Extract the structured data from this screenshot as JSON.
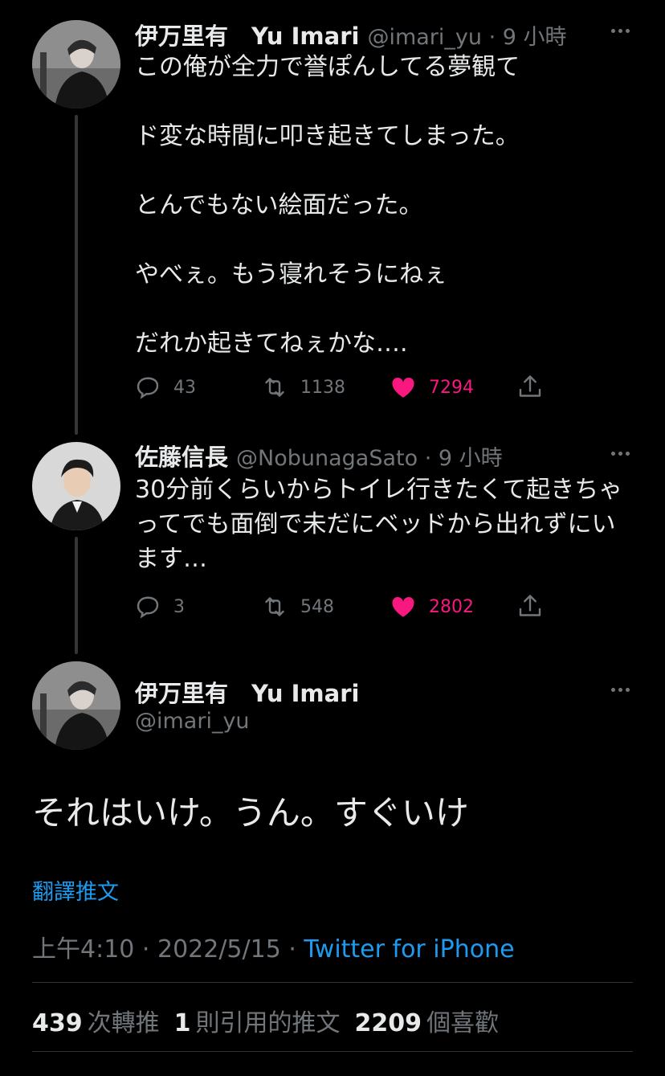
{
  "tweets": [
    {
      "display_name": "伊万里有　Yu Imari",
      "handle": "@imari_yu",
      "time": "9 小時",
      "text": "この俺が全力で誉ぽんしてる夢観て\n\nド変な時間に叩き起きてしまった。\n\nとんでもない絵面だった。\n\nやべぇ。もう寝れそうにねぇ\n\nだれか起きてねぇかな….",
      "replies": "43",
      "retweets": "1138",
      "likes": "7294"
    },
    {
      "display_name": "佐藤信長",
      "handle": "@NobunagaSato",
      "time": "9 小時",
      "text": "30分前くらいからトイレ行きたくて起きちゃってでも面倒で未だにベッドから出れずにいます…",
      "replies": "3",
      "retweets": "548",
      "likes": "2802"
    }
  ],
  "focused": {
    "display_name": "伊万里有　Yu Imari",
    "handle": "@imari_yu",
    "text": "それはいけ。うん。すぐいけ",
    "translate_label": "翻譯推文",
    "timestamp": "上午4:10 · 2022/5/15 · ",
    "source": "Twitter for iPhone",
    "stats": {
      "retweets": "439",
      "retweets_label": "次轉推",
      "quotes": "1",
      "quotes_label": "則引用的推文",
      "likes": "2209",
      "likes_label": "個喜歡"
    }
  },
  "separator": " · ",
  "icons": [
    "reply-icon",
    "retweet-icon",
    "like-icon",
    "share-icon",
    "more-icon"
  ],
  "colors": {
    "background": "#000000",
    "accent": "#1d9bf0",
    "like": "#f91880",
    "muted": "#71767b"
  }
}
